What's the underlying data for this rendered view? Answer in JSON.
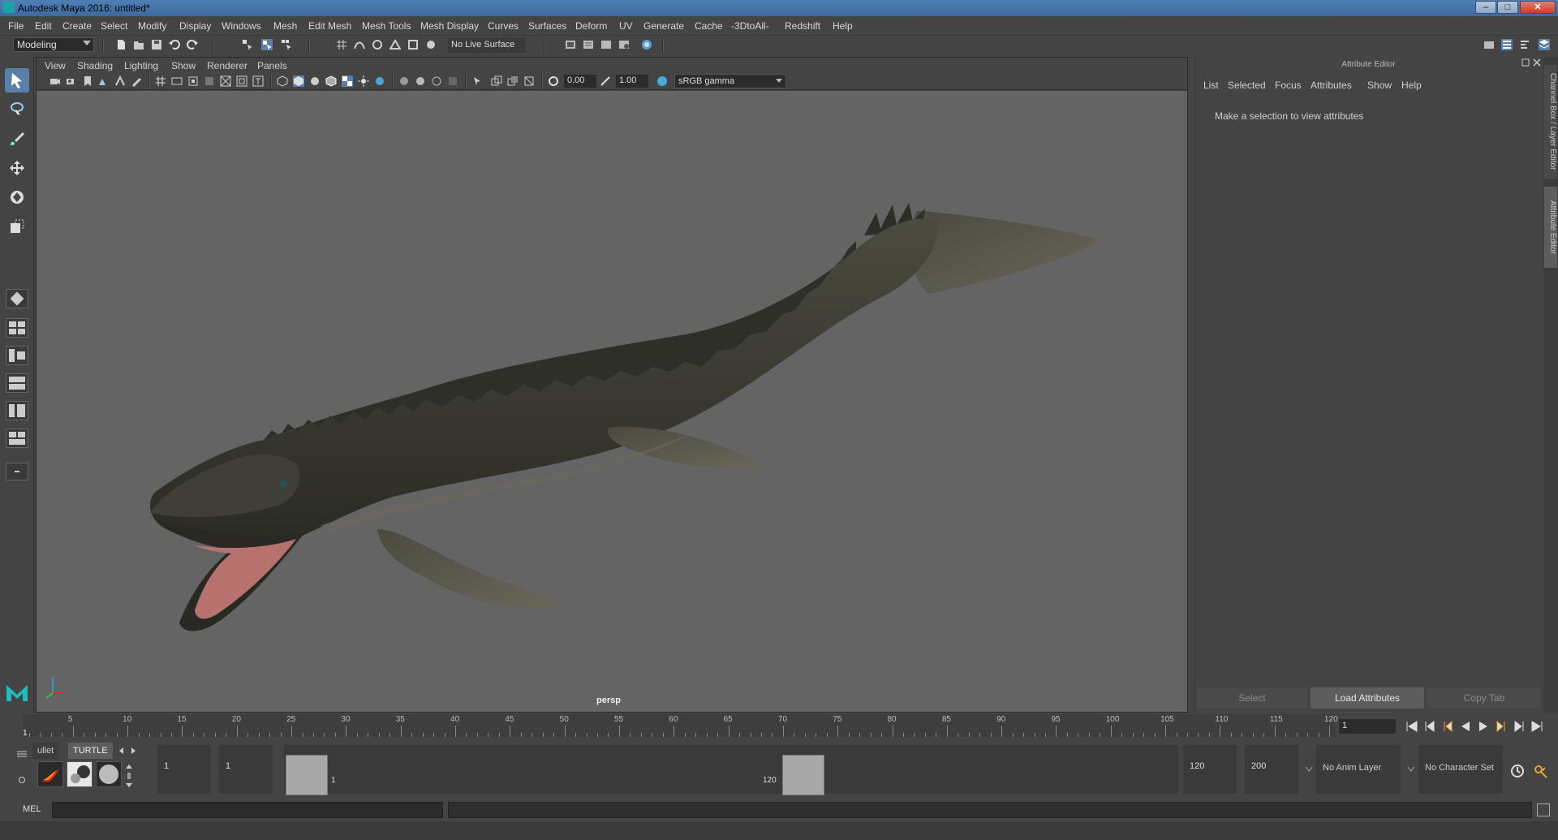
{
  "window": {
    "title": "Autodesk Maya 2016: untitled*",
    "minimize": "–",
    "maximize": "□",
    "close": "✕"
  },
  "menubar": [
    "File",
    "Edit",
    "Create",
    "Select",
    "Modify",
    "Display",
    "Windows",
    "Mesh",
    "Edit Mesh",
    "Mesh Tools",
    "Mesh Display",
    "Curves",
    "Surfaces",
    "Deform",
    "UV",
    "Generate",
    "Cache",
    "-3DtoAll-",
    "Redshift",
    "Help"
  ],
  "statusline": {
    "mode": "Modeling",
    "live_surface": "No Live Surface"
  },
  "viewport": {
    "menu": [
      "View",
      "Shading",
      "Lighting",
      "Show",
      "Renderer",
      "Panels"
    ],
    "exposure": "0.00",
    "gamma": "1.00",
    "color_space": "sRGB gamma",
    "camera": "persp"
  },
  "attribute_editor": {
    "title": "Attribute Editor",
    "menu": [
      "List",
      "Selected",
      "Focus",
      "Attributes",
      "Show",
      "Help"
    ],
    "hint": "Make a selection to view attributes",
    "buttons": {
      "select": "Select",
      "load": "Load Attributes",
      "copy": "Copy Tab"
    },
    "side_tabs": [
      "Channel Box / Layer Editor",
      "Attribute Editor"
    ]
  },
  "timeslider": {
    "tick_labels": [
      "5",
      "10",
      "15",
      "20",
      "25",
      "30",
      "35",
      "40",
      "45",
      "50",
      "55",
      "60",
      "65",
      "70",
      "75",
      "80",
      "85",
      "90",
      "95",
      "100",
      "105",
      "110",
      "115",
      "120"
    ],
    "current_frame_mark": "1",
    "current_frame": "1"
  },
  "range": {
    "shelf_tabs": [
      "ullet",
      "TURTLE"
    ],
    "start_time": "1",
    "playback_start": "1",
    "range_start_label": "1",
    "range_end_label": "120",
    "playback_end": "120",
    "end_time": "200",
    "anim_layer": "No Anim Layer",
    "character_set": "No Character Set"
  },
  "commandline": {
    "label": "MEL"
  },
  "colors": {
    "viewport_bg": "#646464",
    "panel_bg": "#444444",
    "active_tool": "#5a7fa8",
    "title_bar": "#3d6a9f"
  }
}
